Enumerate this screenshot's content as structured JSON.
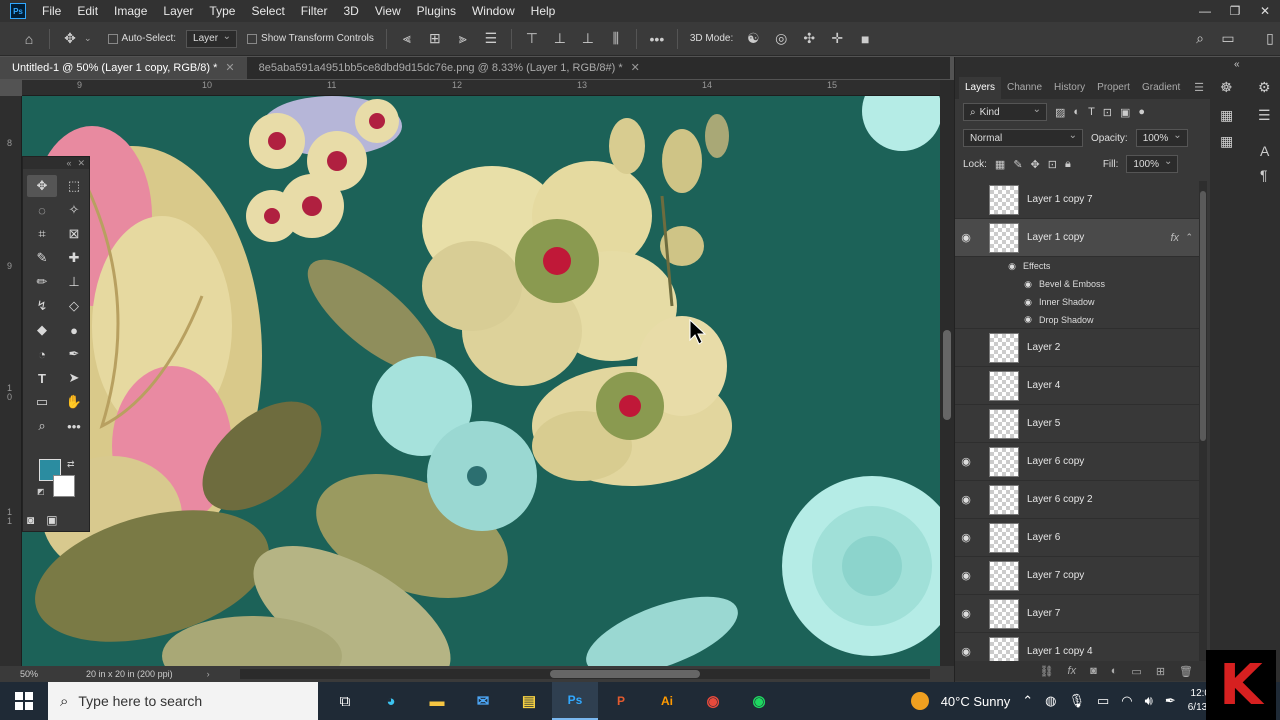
{
  "menu": [
    "File",
    "Edit",
    "Image",
    "Layer",
    "Type",
    "Select",
    "Filter",
    "3D",
    "View",
    "Plugins",
    "Window",
    "Help"
  ],
  "app_logo": "Ps",
  "options": {
    "auto_select_label": "Auto-Select:",
    "auto_select_value": "Layer",
    "show_transform_label": "Show Transform Controls",
    "mode_3d_label": "3D Mode:"
  },
  "tabs": [
    {
      "label": "Untitled-1 @ 50% (Layer 1 copy, RGB/8) *"
    },
    {
      "label": "8e5aba591a4951bb5ce8dbd9d15dc76e.png @ 8.33% (Layer 1, RGB/8#) *"
    }
  ],
  "ruler": {
    "top": [
      "9",
      "10",
      "11",
      "12",
      "13",
      "14",
      "15"
    ],
    "left": [
      "8",
      "9",
      "1\n0",
      "1\n1"
    ]
  },
  "status": {
    "zoom": "50%",
    "doc_size": "20 in x 20 in (200 ppi)"
  },
  "panel": {
    "tabs": [
      "Layers",
      "Channe",
      "History",
      "Propert",
      "Gradient"
    ],
    "filter_kind": "Kind",
    "blend_mode": "Normal",
    "opacity_label": "Opacity:",
    "opacity_value": "100%",
    "lock_label": "Lock:",
    "fill_label": "Fill:",
    "fill_value": "100%"
  },
  "layers": [
    {
      "name": "Layer 1 copy 7",
      "visible": false
    },
    {
      "name": "Layer 1 copy",
      "visible": true,
      "selected": true,
      "fx": "fx"
    },
    {
      "name": "Layer 2",
      "visible": false
    },
    {
      "name": "Layer 4",
      "visible": false
    },
    {
      "name": "Layer 5",
      "visible": false
    },
    {
      "name": "Layer 6 copy",
      "visible": true
    },
    {
      "name": "Layer 6 copy 2",
      "visible": true
    },
    {
      "name": "Layer 6",
      "visible": true
    },
    {
      "name": "Layer 7 copy",
      "visible": true
    },
    {
      "name": "Layer 7",
      "visible": true
    },
    {
      "name": "Layer 1 copy 4",
      "visible": true
    }
  ],
  "effects": {
    "header": "Effects",
    "items": [
      "Bevel & Emboss",
      "Inner Shadow",
      "Drop Shadow"
    ]
  },
  "taskbar": {
    "search_placeholder": "Type here to search",
    "weather": "40°C  Sunny",
    "time": "12:0",
    "date": "6/13,"
  },
  "colors": {
    "canvas_bg": "#1c6258",
    "foreground": "#2b8ca0",
    "background": "#ffffff"
  }
}
